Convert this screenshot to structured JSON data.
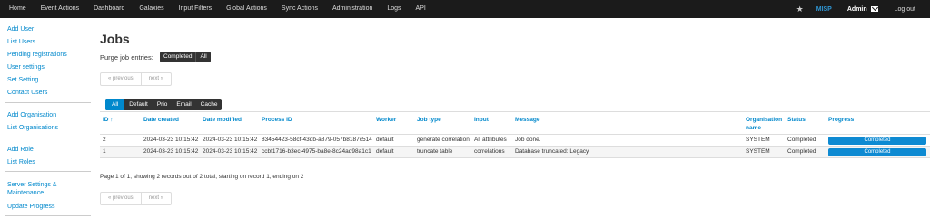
{
  "topnav": {
    "items": [
      "Home",
      "Event Actions",
      "Dashboard",
      "Galaxies",
      "Input Filters",
      "Global Actions",
      "Sync Actions",
      "Administration",
      "Logs",
      "API"
    ],
    "brand": "MISP",
    "user": "Admin",
    "logout": "Log out"
  },
  "sidebar": {
    "groups": [
      [
        "Add User",
        "List Users",
        "Pending registrations",
        "User settings",
        "Set Setting",
        "Contact Users"
      ],
      [
        "Add Organisation",
        "List Organisations"
      ],
      [
        "Add Role",
        "List Roles"
      ],
      [
        "Server Settings & Maintenance",
        "Update Progress"
      ]
    ]
  },
  "page": {
    "title": "Jobs",
    "purge_label": "Purge job entries:",
    "purge_buttons": [
      "Completed",
      "All"
    ]
  },
  "pager": {
    "previous": "« previous",
    "next": "next »"
  },
  "filters": {
    "items": [
      "All",
      "Default",
      "Prio",
      "Email",
      "Cache"
    ],
    "active": "All"
  },
  "table": {
    "headers": [
      "ID ↑",
      "Date created",
      "Date modified",
      "Process ID",
      "Worker",
      "Job type",
      "Input",
      "Message",
      "Organisation name",
      "Status",
      "Progress"
    ],
    "rows": [
      [
        "2",
        "2024-03-23 10:15:42",
        "2024-03-23 10:15:42",
        "83454423-58cf-43db-a879-057b8187c514",
        "default",
        "generate correlation",
        "All attributes",
        "Job done.",
        "SYSTEM",
        "Completed",
        "Completed"
      ],
      [
        "1",
        "2024-03-23 10:15:42",
        "2024-03-23 10:15:42",
        "ccbf1716-b3ec-4975-ba8e-8c24ad98a1c1",
        "default",
        "truncate table",
        "correlations",
        "Database truncated: Legacy",
        "SYSTEM",
        "Completed",
        "Completed"
      ]
    ]
  },
  "paging_info": "Page 1 of 1, showing 2 records out of 2 total, starting on record 1, ending on 2",
  "colors": {
    "topbar": "#1b1b1b",
    "link": "#0088cc",
    "accent": "#0e8ad2",
    "brand": "#2f96d4"
  }
}
